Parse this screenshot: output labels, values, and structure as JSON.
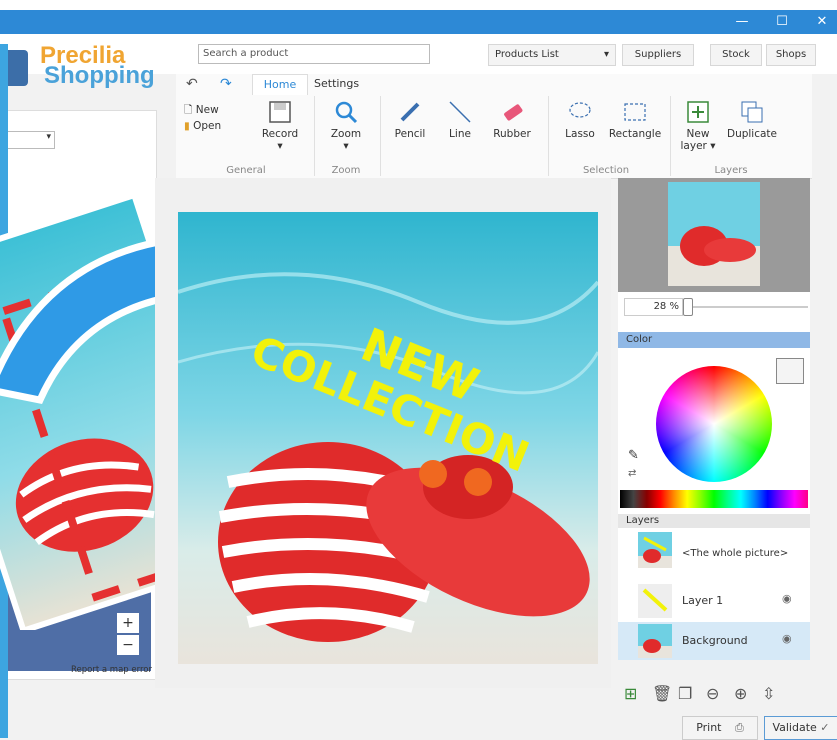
{
  "window": {
    "minimize_glyph": "—",
    "maximize_glyph": "☐",
    "close_glyph": "✕"
  },
  "brand": {
    "line1": "Precilia",
    "line2": "Shopping"
  },
  "search": {
    "placeholder": "Search a product"
  },
  "nav": {
    "products_list": "Products List",
    "suppliers": "Suppliers",
    "stock": "Stock",
    "shops": "Shops"
  },
  "ribbon": {
    "tabs": [
      "Home",
      "Settings"
    ],
    "general": {
      "new": "New",
      "open": "Open",
      "record": "Record",
      "label": "General"
    },
    "zoom": {
      "zoom": "Zoom",
      "label": "Zoom"
    },
    "tools": {
      "pencil": "Pencil",
      "line": "Line",
      "rubber": "Rubber"
    },
    "selection": {
      "lasso": "Lasso",
      "rectangle": "Rectangle",
      "label": "Selection"
    },
    "layers": {
      "new_layer_1": "New",
      "new_layer_2": "layer",
      "duplicate": "Duplicate",
      "label": "Layers"
    }
  },
  "canvas": {
    "headline_1": "NEW",
    "headline_2": "COLLECTION"
  },
  "left_panel": {
    "map_credit": "Report a map error",
    "map_zoom_in": "+",
    "map_zoom_out": "−"
  },
  "zoom_level": {
    "value": "28",
    "unit": "%",
    "fraction": 0.28
  },
  "color_panel": {
    "title": "Color"
  },
  "layers_panel": {
    "title": "Layers",
    "whole": "<The whole picture>",
    "items": [
      {
        "name": "Layer 1",
        "selected": false
      },
      {
        "name": "Background",
        "selected": true
      }
    ]
  },
  "footer": {
    "print": "Print",
    "validate": "Validate"
  },
  "colors": {
    "titlebar": "#2d89d6",
    "accent": "#5b9bd5",
    "selected_row": "#d6e9f7",
    "headline": "#f2f20a"
  }
}
